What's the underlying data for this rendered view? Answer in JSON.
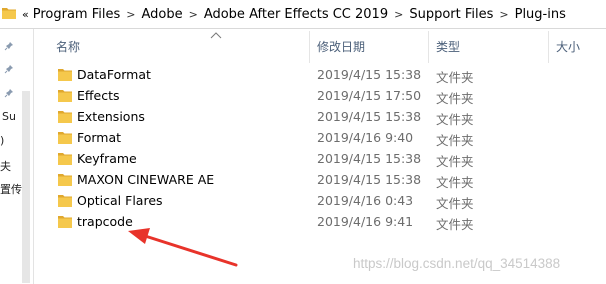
{
  "address_bar": {
    "overflow": "«",
    "separator": ">",
    "crumbs": [
      "Program Files",
      "Adobe",
      "Adobe After Effects CC 2019",
      "Support Files",
      "Plug-ins"
    ]
  },
  "nav_pane": {
    "labels": [
      "Su",
      ")",
      "夫",
      "置传"
    ]
  },
  "columns": {
    "name": "名称",
    "date": "修改日期",
    "type": "类型",
    "size": "大小"
  },
  "files": [
    {
      "name": "DataFormat",
      "date": "2019/4/15 15:38",
      "type": "文件夹"
    },
    {
      "name": "Effects",
      "date": "2019/4/15 17:50",
      "type": "文件夹"
    },
    {
      "name": "Extensions",
      "date": "2019/4/15 15:38",
      "type": "文件夹"
    },
    {
      "name": "Format",
      "date": "2019/4/16 9:40",
      "type": "文件夹"
    },
    {
      "name": "Keyframe",
      "date": "2019/4/15 15:38",
      "type": "文件夹"
    },
    {
      "name": "MAXON CINEWARE AE",
      "date": "2019/4/15 15:38",
      "type": "文件夹"
    },
    {
      "name": "Optical Flares",
      "date": "2019/4/16 0:43",
      "type": "文件夹"
    },
    {
      "name": "trapcode",
      "date": "2019/4/16 9:41",
      "type": "文件夹"
    }
  ],
  "watermark": "https://blog.csdn.net/qq_34514388",
  "colors": {
    "folder": "#f5c84c",
    "folder_tab": "#e0a82e",
    "annotation_arrow": "#e8332a",
    "header_text": "#4c607a"
  }
}
